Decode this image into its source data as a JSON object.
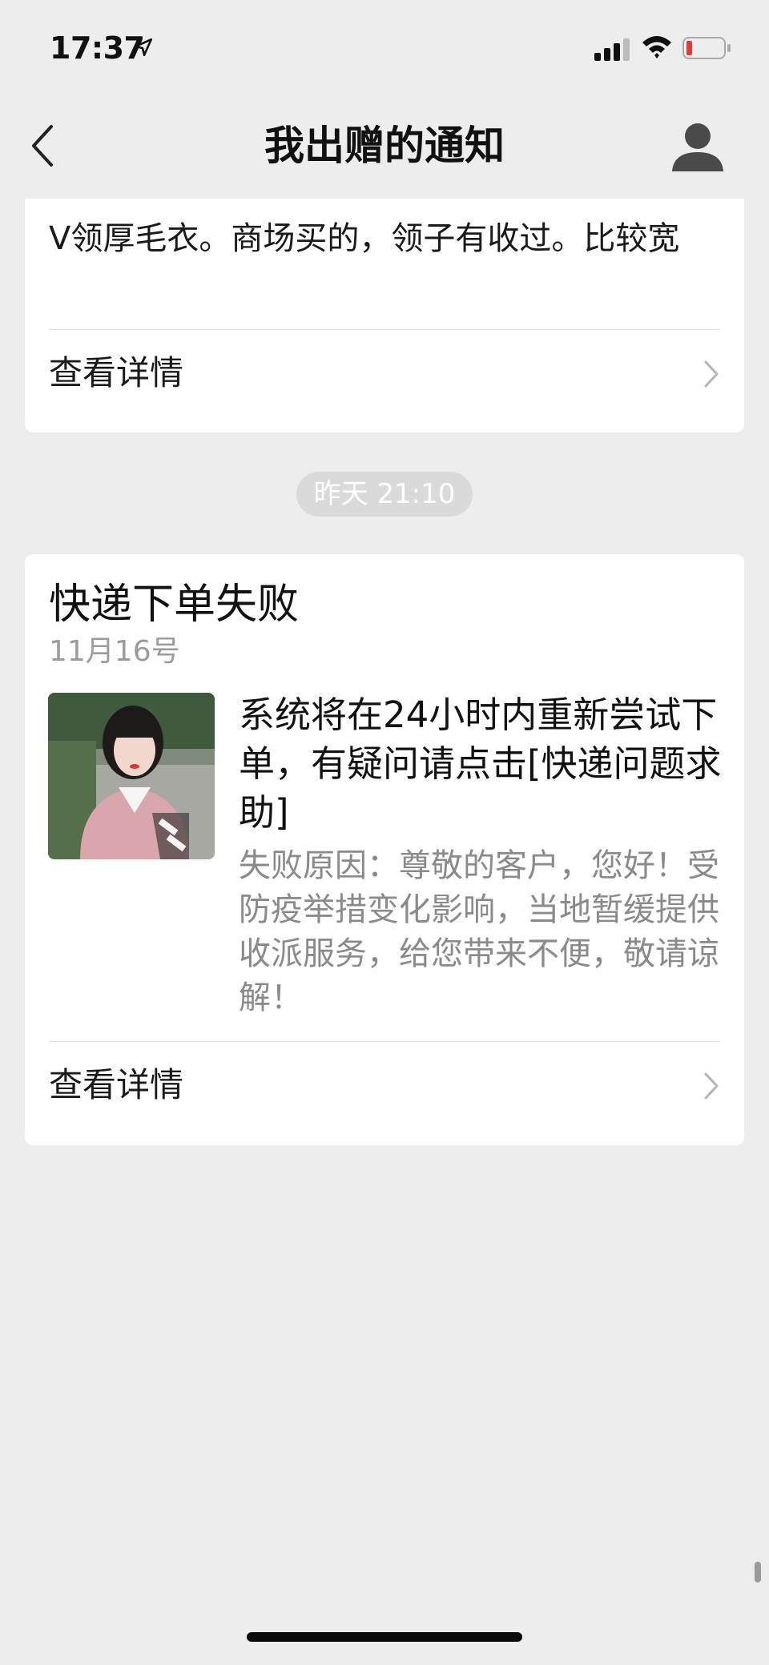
{
  "status_bar": {
    "time": "17:37",
    "icons": [
      "location-arrow-icon",
      "cellular-signal-icon",
      "wifi-icon",
      "battery-low-icon"
    ],
    "battery_color": "#e53935"
  },
  "nav": {
    "title": "我出赠的通知",
    "back_icon": "chevron-left-icon",
    "profile_icon": "user-silhouette-icon"
  },
  "notifications": [
    {
      "description": "V领厚毛衣。商场买的，领子有收过。比较宽",
      "detail_label": "查看详情"
    },
    {
      "timestamp": "昨天 21:10",
      "title": "快递下单失败",
      "date": "11月16号",
      "message": "系统将在24小时内重新尝试下单，有疑问请点击[快递问题求助]",
      "reason": "失败原因：尊敬的客户，您好！受防疫举措变化影响，当地暂缓提供收派服务，给您带来不便，敬请谅解！",
      "detail_label": "查看详情"
    }
  ],
  "colors": {
    "background": "#ededed",
    "card": "#ffffff",
    "secondary_text": "#8a8a8a",
    "pill": "#dadada"
  }
}
